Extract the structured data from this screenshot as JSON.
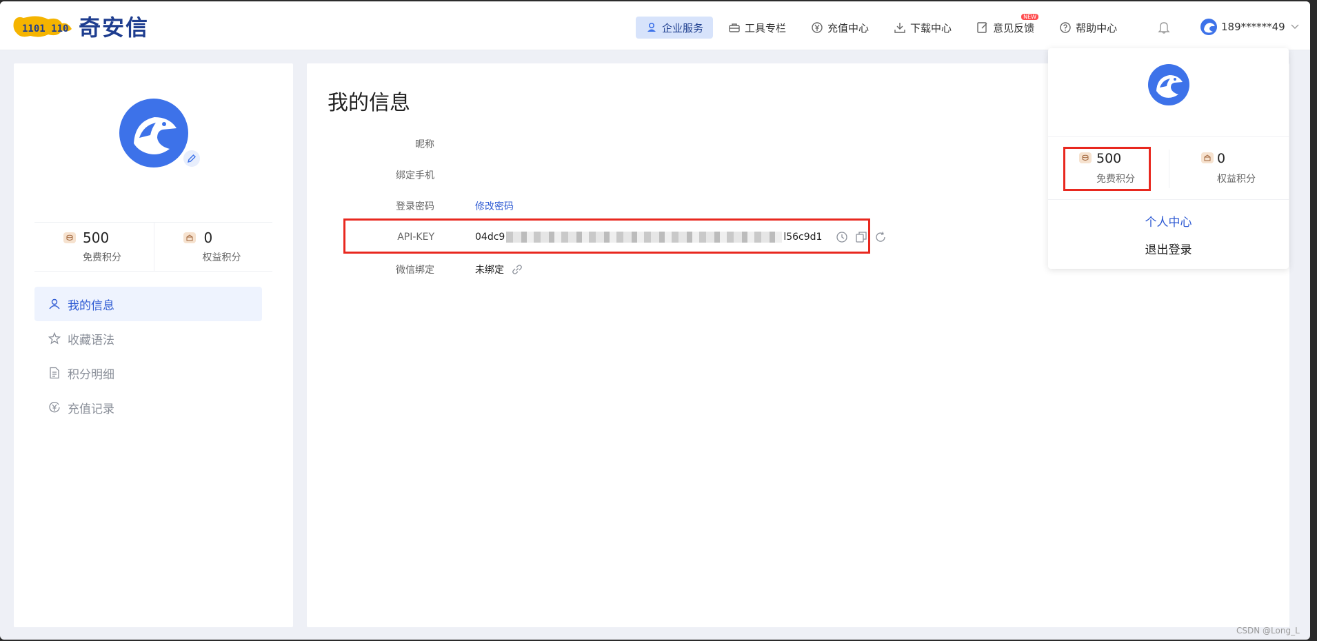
{
  "brand": {
    "name": "奇安信",
    "logo_digits": "1101 110"
  },
  "nav": {
    "items": [
      {
        "label": "企业服务",
        "icon": "enterprise-icon",
        "active": true
      },
      {
        "label": "工具专栏",
        "icon": "toolbox-icon"
      },
      {
        "label": "充值中心",
        "icon": "yen-coin-icon"
      },
      {
        "label": "下载中心",
        "icon": "download-icon"
      },
      {
        "label": "意见反馈",
        "icon": "feedback-icon",
        "badge": "NEW"
      },
      {
        "label": "帮助中心",
        "icon": "help-icon"
      }
    ],
    "bell_icon": "bell-icon",
    "user_phone": "189******49"
  },
  "profile": {
    "free_points_value": "500",
    "free_points_label": "免费积分",
    "rights_points_value": "0",
    "rights_points_label": "权益积分"
  },
  "sidebar": {
    "items": [
      {
        "label": "我的信息",
        "icon": "user-icon",
        "active": true
      },
      {
        "label": "收藏语法",
        "icon": "star-icon"
      },
      {
        "label": "积分明细",
        "icon": "document-icon"
      },
      {
        "label": "充值记录",
        "icon": "yen-coin-icon"
      }
    ]
  },
  "main": {
    "title": "我的信息",
    "fields": {
      "nickname_label": "昵称",
      "phone_label": "绑定手机",
      "password_label": "登录密码",
      "password_action": "修改密码",
      "apikey_label": "API-KEY",
      "apikey_prefix": "04dc9",
      "apikey_suffix": "l56c9d1",
      "wechat_label": "微信绑定",
      "wechat_value": "未绑定"
    }
  },
  "dropdown": {
    "free_points_value": "500",
    "free_points_label": "免费积分",
    "rights_points_value": "0",
    "rights_points_label": "权益积分",
    "personal_center": "个人中心",
    "logout": "退出登录"
  },
  "watermark": "CSDN @Long_L",
  "colors": {
    "accent": "#2f5bd3",
    "highlight_border": "#e8281f",
    "avatar_blue": "#3d72e9"
  }
}
